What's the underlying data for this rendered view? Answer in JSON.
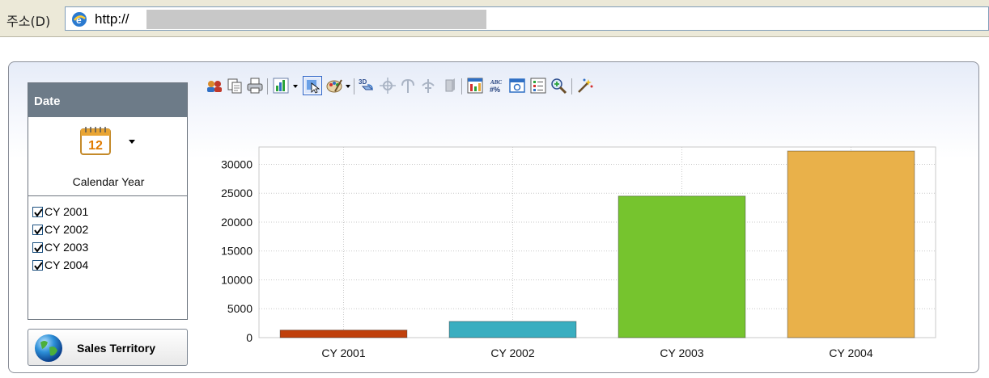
{
  "address_bar": {
    "label": "주소(D)",
    "url_prefix": "http://"
  },
  "date_filter": {
    "header": "Date",
    "level_label": "Calendar Year",
    "calendar_icon_day": "12",
    "years": [
      {
        "label": "CY 2001",
        "checked": true
      },
      {
        "label": "CY 2002",
        "checked": true
      },
      {
        "label": "CY 2003",
        "checked": true
      },
      {
        "label": "CY 2004",
        "checked": true
      }
    ]
  },
  "dimension_button": {
    "label": "Sales Territory",
    "icon": "globe-icon"
  },
  "toolbar": {
    "icons": [
      "users-icon",
      "copy-icon",
      "print-icon",
      "chart-type-icon",
      "select-icon",
      "palette-icon",
      "3d-icon",
      "move-icon",
      "rotate-icon",
      "elevate-icon",
      "depth-icon",
      "chart-data-icon",
      "data-labels-icon",
      "preview-icon",
      "legend-icon",
      "zoom-icon",
      "wizard-icon"
    ],
    "data_labels_text": "ABC",
    "data_labels_sub": "#%"
  },
  "chart_data": {
    "type": "bar",
    "categories": [
      "CY 2001",
      "CY 2002",
      "CY 2003",
      "CY 2004"
    ],
    "values": [
      1300,
      2800,
      24500,
      32300
    ],
    "colors": [
      "#c0400c",
      "#3aaec0",
      "#76c42e",
      "#e9b14a"
    ],
    "yticks": [
      0,
      5000,
      10000,
      15000,
      20000,
      25000,
      30000
    ],
    "ylim": [
      0,
      33000
    ],
    "grid": true
  }
}
